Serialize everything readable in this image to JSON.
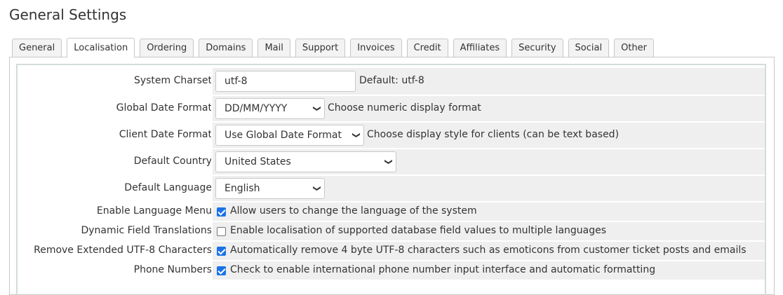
{
  "page": {
    "title": "General Settings"
  },
  "tabs": [
    {
      "label": "General",
      "active": false
    },
    {
      "label": "Localisation",
      "active": true
    },
    {
      "label": "Ordering",
      "active": false
    },
    {
      "label": "Domains",
      "active": false
    },
    {
      "label": "Mail",
      "active": false
    },
    {
      "label": "Support",
      "active": false
    },
    {
      "label": "Invoices",
      "active": false
    },
    {
      "label": "Credit",
      "active": false
    },
    {
      "label": "Affiliates",
      "active": false
    },
    {
      "label": "Security",
      "active": false
    },
    {
      "label": "Social",
      "active": false
    },
    {
      "label": "Other",
      "active": false
    }
  ],
  "settings": {
    "charset": {
      "label": "System Charset",
      "value": "utf-8",
      "hint": "Default: utf-8"
    },
    "global_date": {
      "label": "Global Date Format",
      "value": "DD/MM/YYYY",
      "hint": "Choose numeric display format"
    },
    "client_date": {
      "label": "Client Date Format",
      "value": "Use Global Date Format",
      "hint": "Choose display style for clients (can be text based)"
    },
    "country": {
      "label": "Default Country",
      "value": "United States"
    },
    "language": {
      "label": "Default Language",
      "value": "English"
    },
    "language_menu": {
      "label": "Enable Language Menu",
      "checked": true,
      "hint": "Allow users to change the language of the system"
    },
    "field_translations": {
      "label": "Dynamic Field Translations",
      "checked": false,
      "hint": "Enable localisation of supported database field values to multiple languages"
    },
    "remove_utf8": {
      "label": "Remove Extended UTF-8 Characters",
      "checked": true,
      "hint": "Automatically remove 4 byte UTF-8 characters such as emoticons from customer ticket posts and emails"
    },
    "phone_numbers": {
      "label": "Phone Numbers",
      "checked": true,
      "hint": "Check to enable international phone number input interface and automatic formatting"
    }
  },
  "colors": {
    "accent": "#1a73e8",
    "row_bg": "#efefef"
  }
}
